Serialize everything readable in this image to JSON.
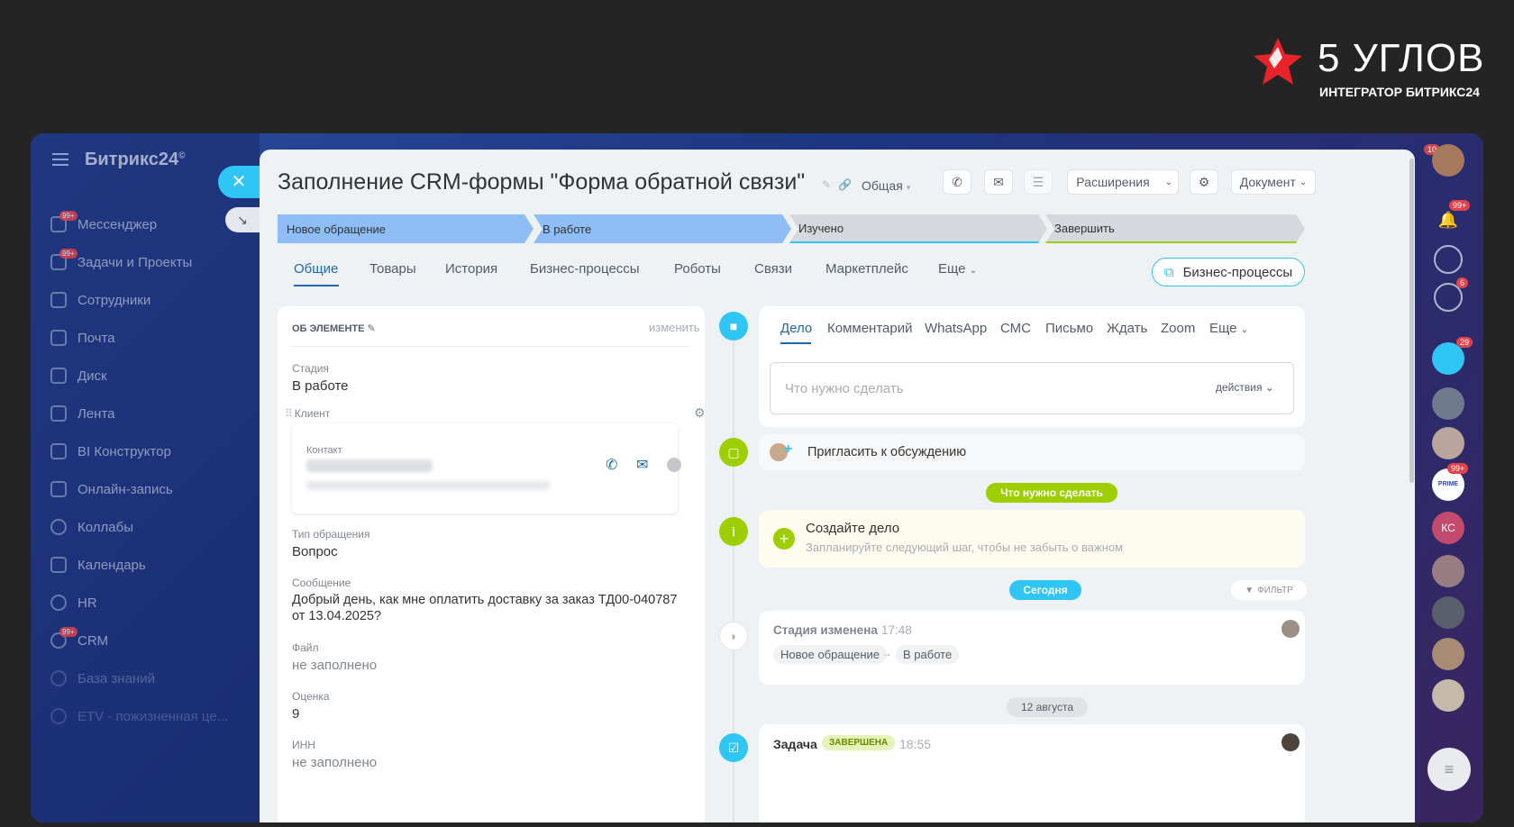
{
  "brand": {
    "name": "5 УГЛОВ",
    "subtitle": "ИНТЕГРАТОР БИТРИКС24",
    "accent": "#e8232a"
  },
  "sidebar": {
    "title": "Битрикс24",
    "copyright": "©",
    "items": [
      {
        "label": "Мессенджер",
        "badge": "99+"
      },
      {
        "label": "Задачи и Проекты",
        "badge": "99+"
      },
      {
        "label": "Сотрудники"
      },
      {
        "label": "Почта"
      },
      {
        "label": "Диск"
      },
      {
        "label": "Лента"
      },
      {
        "label": "BI Конструктор"
      },
      {
        "label": "Онлайн-запись"
      },
      {
        "label": "Коллабы"
      },
      {
        "label": "Календарь"
      },
      {
        "label": "HR"
      },
      {
        "label": "CRM",
        "badge": "99+"
      },
      {
        "label": "База знаний"
      },
      {
        "label": "ETV - пожизненная це..."
      }
    ]
  },
  "buttons": {
    "close": "✕",
    "collapse": "↘"
  },
  "panel": {
    "title": "Заполнение CRM-формы \"Форма обратной связи\"",
    "category": "Общая",
    "toolbar": {
      "extensions": "Расширения",
      "document": "Документ"
    },
    "stages": [
      {
        "label": "Новое обращение",
        "color": "#8fbdf5"
      },
      {
        "label": "В работе",
        "color": "#8fbdf5"
      },
      {
        "label": "Изучено",
        "color": "#d5d8dc"
      },
      {
        "label": "Завершить",
        "color": "#d5d8dc"
      }
    ],
    "tabs": [
      "Общие",
      "Товары",
      "История",
      "Бизнес-процессы",
      "Роботы",
      "Связи",
      "Маркетплейс",
      "Еще"
    ],
    "bp_button": "Бизнес-процессы"
  },
  "details": {
    "section_title": "ОБ ЭЛЕМЕНТЕ",
    "edit": "изменить",
    "stage_label": "Стадия",
    "stage_value": "В работе",
    "client_label": "Клиент",
    "contact_label": "Контакт",
    "type_label": "Тип обращения",
    "type_value": "Вопрос",
    "message_label": "Сообщение",
    "message_value_1": "Добрый день, как мне оплатить доставку за заказ ТД00-040787",
    "message_value_2": "от 13.04.2025?",
    "file_label": "Файл",
    "file_value": "не заполнено",
    "rating_label": "Оценка",
    "rating_value": "9",
    "inn_label": "ИНН",
    "inn_value": "не заполнено"
  },
  "timeline": {
    "tabs": [
      "Дело",
      "Комментарий",
      "WhatsApp",
      "СМС",
      "Письмо",
      "Ждать",
      "Zoom",
      "Еще"
    ],
    "input_placeholder": "Что нужно сделать",
    "actions": "действия",
    "invite": "Пригласить к обсуждению",
    "todo_pill": "Что нужно сделать",
    "create_title": "Создайте дело",
    "create_sub": "Запланируйте следующий шаг, чтобы не забыть о важном",
    "today_pill": "Сегодня",
    "filter": "ФИЛЬТР",
    "stage_changed": "Стадия изменена",
    "stage_time": "17:48",
    "stage_from": "Новое обращение",
    "stage_to": "В работе",
    "date_pill": "12 августа",
    "task_title": "Задача",
    "task_status": "ЗАВЕРШЕНА",
    "task_time": "18:55"
  },
  "right_bar": {
    "badges": {
      "top": "10",
      "notifications": "99+",
      "tasks": "6",
      "chat": "29",
      "prime": "99+"
    },
    "initials": "КС",
    "prime_label": "PRIME FOODS"
  }
}
